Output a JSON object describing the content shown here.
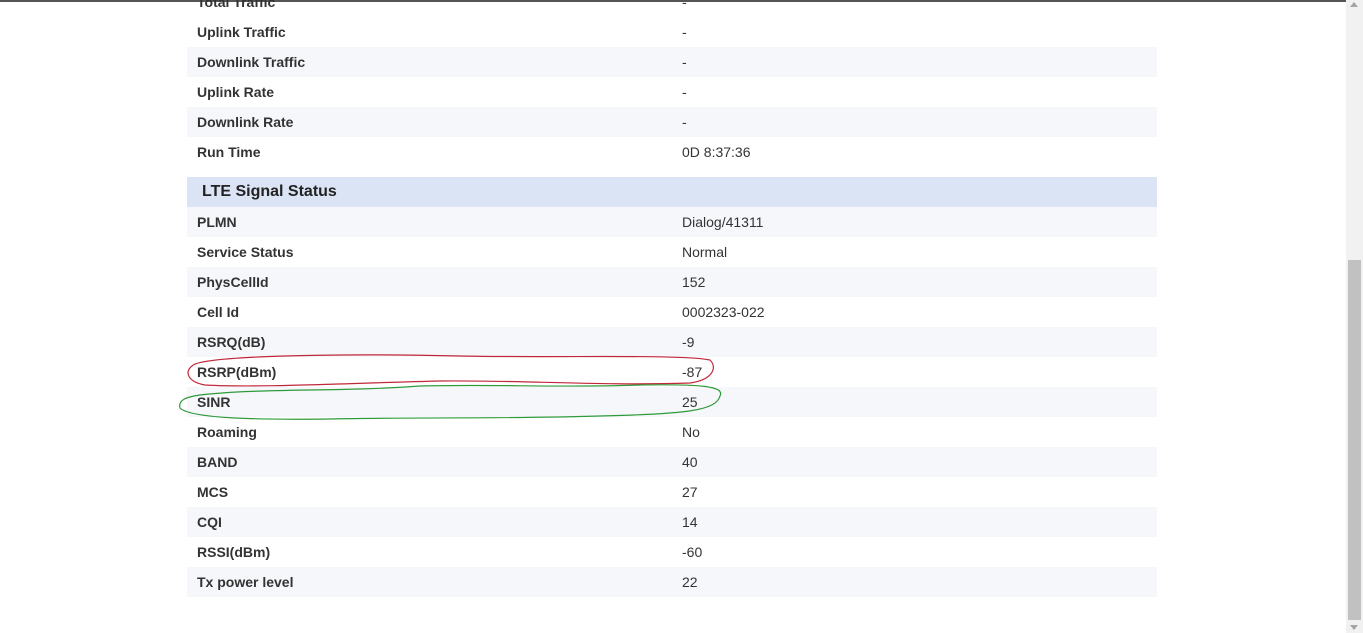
{
  "traffic_rows": [
    {
      "label": "Total Traffic",
      "value": "-"
    },
    {
      "label": "Uplink Traffic",
      "value": "-"
    },
    {
      "label": "Downlink Traffic",
      "value": "-"
    },
    {
      "label": "Uplink Rate",
      "value": "-"
    },
    {
      "label": "Downlink Rate",
      "value": "-"
    },
    {
      "label": "Run Time",
      "value": "0D   8:37:36"
    }
  ],
  "lte_section": {
    "title": "LTE Signal Status",
    "rows": [
      {
        "label": "PLMN",
        "value": "Dialog/41311"
      },
      {
        "label": "Service Status",
        "value": "Normal"
      },
      {
        "label": "PhysCellId",
        "value": "152"
      },
      {
        "label": "Cell Id",
        "value": "0002323-022"
      },
      {
        "label": "RSRQ(dB)",
        "value": "-9"
      },
      {
        "label": "RSRP(dBm)",
        "value": "-87"
      },
      {
        "label": "SINR",
        "value": "25"
      },
      {
        "label": "Roaming",
        "value": "No"
      },
      {
        "label": "BAND",
        "value": "40"
      },
      {
        "label": "MCS",
        "value": "27"
      },
      {
        "label": "CQI",
        "value": "14"
      },
      {
        "label": "RSSI(dBm)",
        "value": "-60"
      },
      {
        "label": "Tx power level",
        "value": "22"
      }
    ]
  },
  "annotation_colors": {
    "rsrp_circle": "#c0283a",
    "sinr_circle": "#2e9b3a"
  },
  "colors": {
    "row_shade": "#f5f7fa",
    "section_header_bg": "#dae4f4"
  }
}
